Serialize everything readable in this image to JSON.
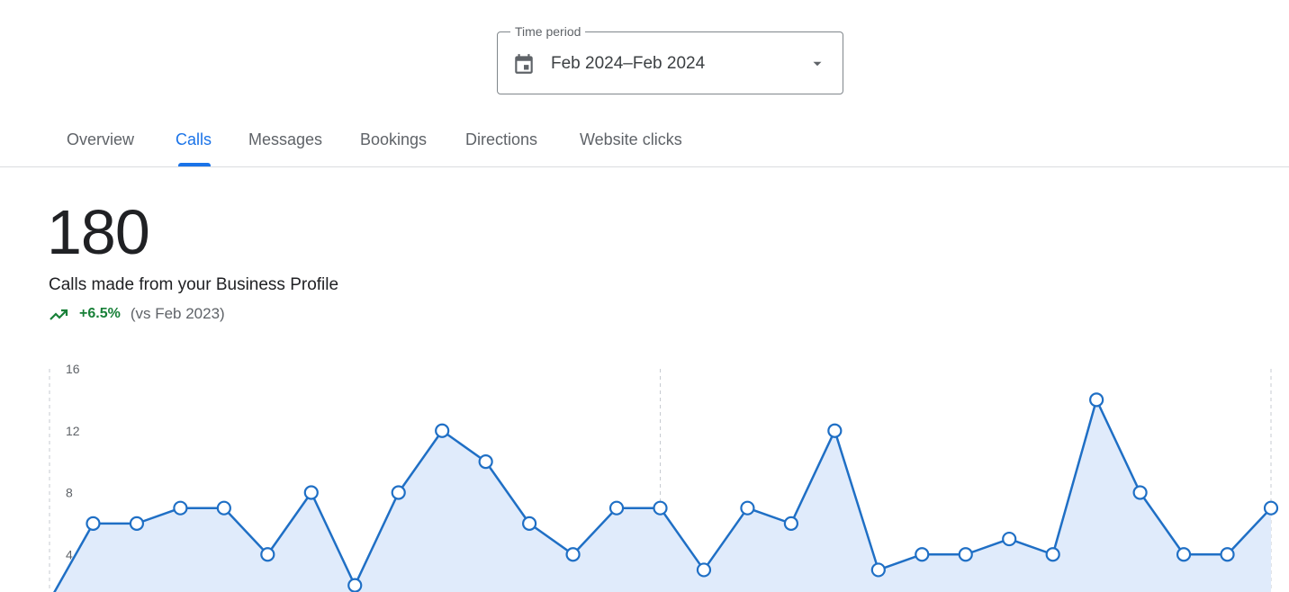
{
  "time_period": {
    "label": "Time period",
    "value": "Feb 2024–Feb 2024",
    "calendar_icon": "calendar-icon",
    "dropdown_icon": "arrow-drop-down-icon"
  },
  "tabs": [
    {
      "label": "Overview",
      "active": false
    },
    {
      "label": "Calls",
      "active": true
    },
    {
      "label": "Messages",
      "active": false
    },
    {
      "label": "Bookings",
      "active": false
    },
    {
      "label": "Directions",
      "active": false
    },
    {
      "label": "Website clicks",
      "active": false
    }
  ],
  "metric": {
    "value": "180",
    "description": "Calls made from your Business Profile",
    "trend": {
      "icon": "trending-up-icon",
      "value": "+6.5%",
      "comparison": "(vs Feb 2023)",
      "color": "#188038"
    }
  },
  "colors": {
    "accent": "#1a73e8",
    "line": "#1f6fc5",
    "area": "#e0ebfb"
  },
  "chart_data": {
    "type": "area",
    "title": "",
    "xlabel": "",
    "ylabel": "",
    "ylim": [
      0,
      16
    ],
    "y_ticks": [
      "4",
      "8",
      "12",
      "16"
    ],
    "x": [
      1,
      2,
      3,
      4,
      5,
      6,
      7,
      8,
      9,
      10,
      11,
      12,
      13,
      14,
      15,
      16,
      17,
      18,
      19,
      20,
      21,
      22,
      23,
      24,
      25,
      26,
      27,
      28,
      29
    ],
    "series": [
      {
        "values": [
          1,
          6,
          6,
          7,
          7,
          4,
          8,
          2,
          8,
          12,
          10,
          6,
          4,
          7,
          7,
          3,
          7,
          6,
          12,
          3,
          4,
          4,
          5,
          4,
          14,
          8,
          4,
          4,
          7
        ]
      }
    ],
    "grid": "vertical dashed lines",
    "legend": "none"
  }
}
